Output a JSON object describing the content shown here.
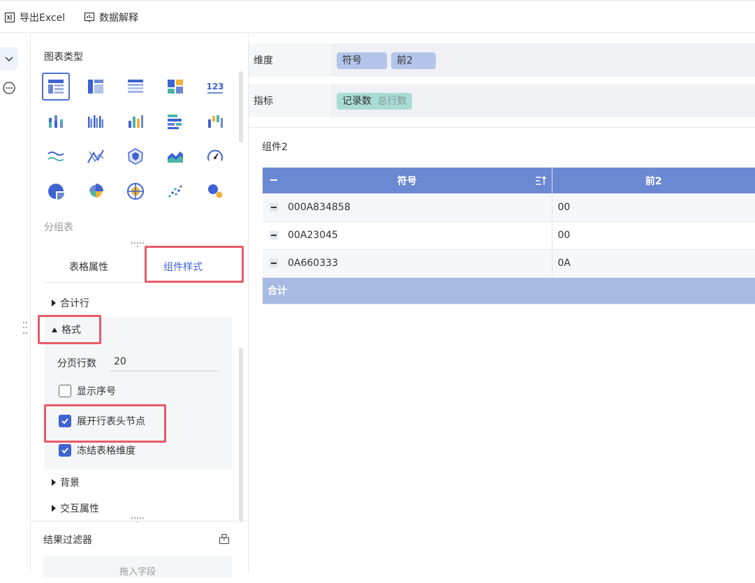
{
  "toolbar": {
    "export_label": "导出Excel",
    "explain_label": "数据解释"
  },
  "panel": {
    "chart_type_title": "图表类型",
    "chart_types": [
      {
        "name": "group-table-icon",
        "selected": true
      },
      {
        "name": "cross-table-icon",
        "selected": false
      },
      {
        "name": "detail-table-icon",
        "selected": false
      },
      {
        "name": "treemap-icon",
        "selected": false
      },
      {
        "name": "kpi-number-icon",
        "label": "123",
        "selected": false
      },
      {
        "name": "stacked-bar-icon",
        "selected": false
      },
      {
        "name": "grouped-bar-icon",
        "selected": false
      },
      {
        "name": "bar-chart-icon",
        "selected": false
      },
      {
        "name": "horizontal-bar-icon",
        "selected": false
      },
      {
        "name": "waterfall-icon",
        "selected": false
      },
      {
        "name": "line-chart-icon",
        "selected": false
      },
      {
        "name": "multi-line-icon",
        "selected": false
      },
      {
        "name": "radar-chart-icon",
        "selected": false
      },
      {
        "name": "area-chart-icon",
        "selected": false
      },
      {
        "name": "gauge-icon",
        "selected": false
      },
      {
        "name": "pie-chart-icon",
        "selected": false
      },
      {
        "name": "rose-chart-icon",
        "selected": false
      },
      {
        "name": "target-chart-icon",
        "selected": false
      },
      {
        "name": "scatter-icon",
        "selected": false
      },
      {
        "name": "bubble-icon",
        "selected": false
      }
    ],
    "chart_type_name": "分组表",
    "tabs": {
      "table_props": "表格属性",
      "component_style": "组件样式",
      "active": "组件样式"
    },
    "sections": {
      "total_row": "合计行",
      "format": "格式",
      "background": "背景",
      "interaction": "交互属性"
    },
    "format": {
      "page_rows_label": "分页行数",
      "page_rows_value": "20",
      "show_index_label": "显示序号",
      "show_index": false,
      "expand_header_label": "展开行表头节点",
      "expand_header": true,
      "freeze_dim_label": "冻结表格维度",
      "freeze_dim": true
    },
    "filter": {
      "title": "结果过滤器",
      "drop_hint": "拖入字段"
    }
  },
  "fields": {
    "dimension_label": "维度",
    "dimensions": [
      "符号",
      "前2"
    ],
    "measure_label": "指标",
    "measure": {
      "name": "记录数",
      "sub": "总行数"
    }
  },
  "widget": {
    "title": "组件2",
    "columns": [
      "符号",
      "前2"
    ],
    "rows": [
      {
        "symbol": "000A834858",
        "prefix": "00"
      },
      {
        "symbol": "00A23045",
        "prefix": "00"
      },
      {
        "symbol": "0A660333",
        "prefix": "0A"
      }
    ],
    "total_label": "合计"
  },
  "colors": {
    "accent": "#3f63d2",
    "header_bg": "#6b88d3",
    "total_bg": "#a6bae3",
    "highlight": "#e85a6a",
    "dim_pill": "#b3c5ea",
    "measure_pill": "#a9dcd4"
  }
}
